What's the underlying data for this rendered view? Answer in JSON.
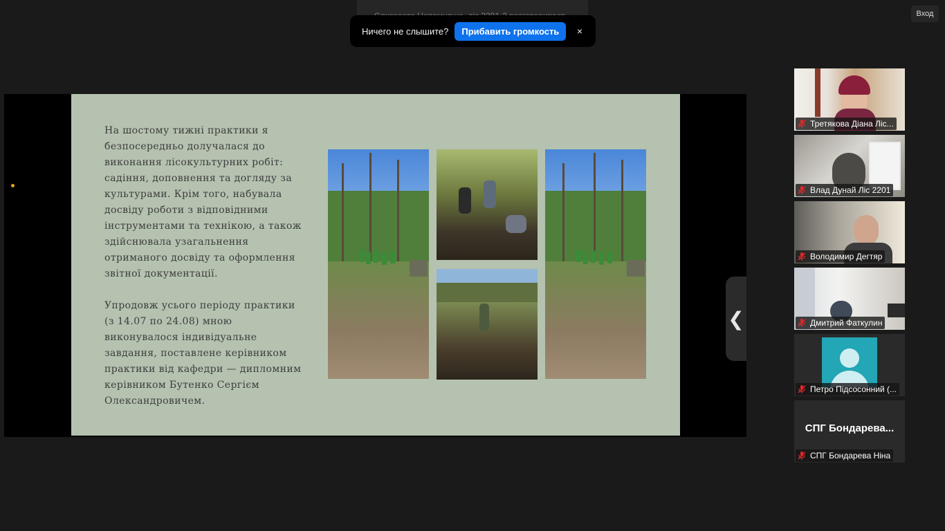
{
  "speaking_banner": "Єлизавета Непомняща, ліс 2201-2 разговаривает...",
  "audio_toast": {
    "message": "Ничего не слышите?",
    "button": "Прибавить громкость",
    "close_icon": "×"
  },
  "login_button": "Вход",
  "slide": {
    "paragraph1": "На шостому тижні практики я безпосередньо долучалася до виконання лісокультурних робіт: садіння, доповнення та догляду за культурами. Крім того, набувала досвіду роботи з відповідними інструментами та технікою, а також здійснювала узагальнення отриманого досвіду та оформлення звітної документації.",
    "paragraph2": "Упродовж усього періоду практики (з 14.07 по 24.08) мною виконувалося індивідуальне завдання, поставлене керівником практики від кафедри — дипломним керівником Бутенко Сергієм Олександровичем."
  },
  "collapse_icon": "❮",
  "participants": [
    {
      "name": "Третякова Діана  Ліс...",
      "video": "camera"
    },
    {
      "name": "Влад Дунай Ліс 2201",
      "video": "camera"
    },
    {
      "name": "Володимир Дегтяр",
      "video": "camera"
    },
    {
      "name": "Дмитрий Фаткулин",
      "video": "camera"
    },
    {
      "name": "Петро Підсосонний (...",
      "video": "avatar"
    },
    {
      "name": "СПГ Бондарева Ніна",
      "video": "initials",
      "display": "СПГ  Бондарева..."
    }
  ],
  "colors": {
    "accent_blue": "#0e72ed",
    "muted_red": "#e02828",
    "avatar_teal": "#23a6b5",
    "slide_bg": "#b5c2b0"
  }
}
